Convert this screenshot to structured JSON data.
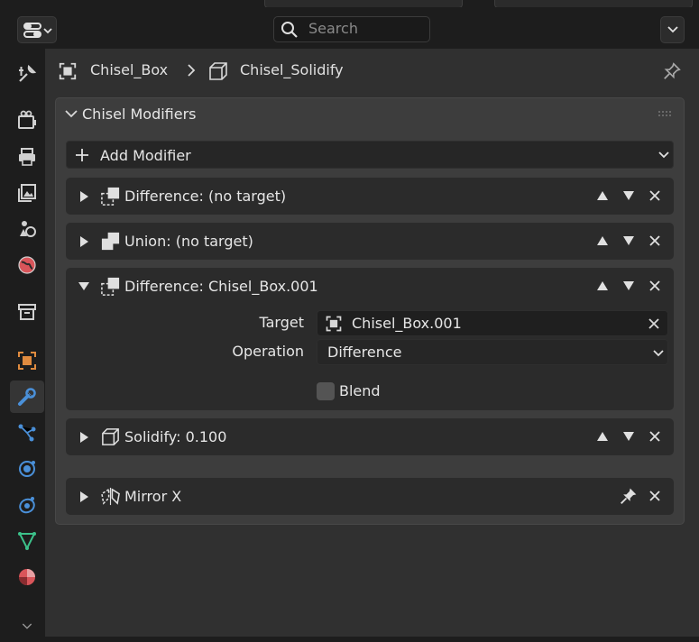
{
  "header": {
    "search_placeholder": "Search"
  },
  "breadcrumb": {
    "object": "Chisel_Box",
    "modifier": "Chisel_Solidify"
  },
  "panel": {
    "title": "Chisel Modifiers",
    "add_modifier_label": "Add Modifier"
  },
  "modifiers": [
    {
      "label": "Difference: (no target)",
      "expanded": false,
      "icon": "difference-icon"
    },
    {
      "label": "Union: (no target)",
      "expanded": false,
      "icon": "union-icon"
    },
    {
      "label": "Difference: Chisel_Box.001",
      "expanded": true,
      "icon": "difference-icon",
      "target_label": "Target",
      "target_value": "Chisel_Box.001",
      "operation_label": "Operation",
      "operation_value": "Difference",
      "blend_label": "Blend",
      "blend_checked": false
    },
    {
      "label": "Solidify: 0.100",
      "expanded": false,
      "icon": "solidify-icon"
    },
    {
      "label": "Mirror X",
      "expanded": false,
      "icon": "mirror-icon"
    }
  ],
  "colors": {
    "accent_orange": "#e08b3f",
    "accent_blue": "#4a90d9",
    "accent_green": "#3cc18a",
    "accent_red": "#d9555a"
  }
}
